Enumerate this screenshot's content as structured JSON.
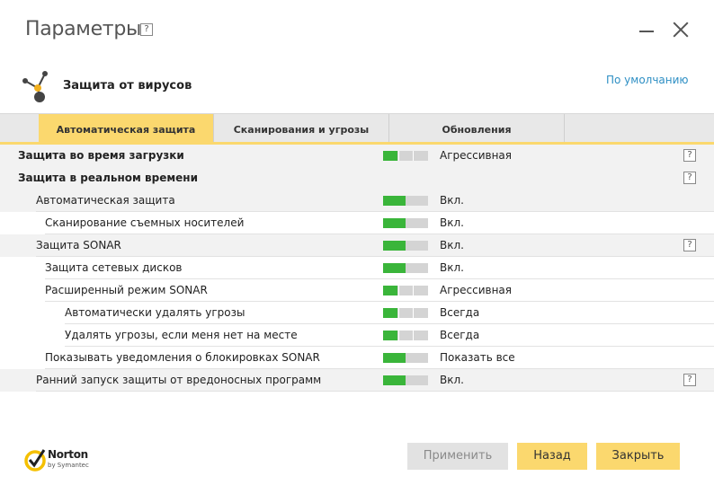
{
  "window": {
    "title": "Параметры",
    "help_label": "?"
  },
  "section": {
    "title": "Защита от вирусов",
    "defaults_link": "По умолчанию"
  },
  "tabs": [
    {
      "label": "Автоматическая защита",
      "active": true
    },
    {
      "label": "Сканирования и угрозы",
      "active": false
    },
    {
      "label": "Обновления",
      "active": false
    }
  ],
  "rows": [
    {
      "label": "Защита во время загрузки",
      "value": "Агрессивная",
      "level": "aggressive",
      "group": true,
      "help": true,
      "indent": 0
    },
    {
      "label": "Защита в реальном времени",
      "value": "",
      "level": "",
      "group": true,
      "help": true,
      "indent": 0
    },
    {
      "label": "Автоматическая защита",
      "value": "Вкл.",
      "level": "on",
      "group": false,
      "help": false,
      "indent": 1
    },
    {
      "label": "Сканирование съемных носителей",
      "value": "Вкл.",
      "level": "on",
      "group": false,
      "help": false,
      "indent": 2
    },
    {
      "label": "Защита SONAR",
      "value": "Вкл.",
      "level": "on",
      "group": false,
      "help": true,
      "indent": 1
    },
    {
      "label": "Защита сетевых дисков",
      "value": "Вкл.",
      "level": "on",
      "group": false,
      "help": false,
      "indent": 2
    },
    {
      "label": "Расширенный режим SONAR",
      "value": "Агрессивная",
      "level": "aggressive",
      "group": false,
      "help": false,
      "indent": 2
    },
    {
      "label": "Автоматически удалять угрозы",
      "value": "Всегда",
      "level": "aggressive",
      "group": false,
      "help": false,
      "indent": 3
    },
    {
      "label": "Удалять угрозы, если меня нет на месте",
      "value": "Всегда",
      "level": "aggressive",
      "group": false,
      "help": false,
      "indent": 3
    },
    {
      "label": "Показывать уведомления о блокировках SONAR",
      "value": "Показать все",
      "level": "on",
      "group": false,
      "help": false,
      "indent": 2
    },
    {
      "label": "Ранний запуск защиты от вредоносных программ",
      "value": "Вкл.",
      "level": "on",
      "group": false,
      "help": true,
      "indent": 1
    }
  ],
  "brand": {
    "name": "Norton",
    "sub": "by Symantec"
  },
  "buttons": {
    "apply": "Применить",
    "back": "Назад",
    "close": "Закрыть"
  },
  "colors": {
    "accent": "#fbd86e",
    "slider_on": "#3ab53a",
    "slider_off": "#d4d4d4",
    "link": "#2e8fc4"
  }
}
